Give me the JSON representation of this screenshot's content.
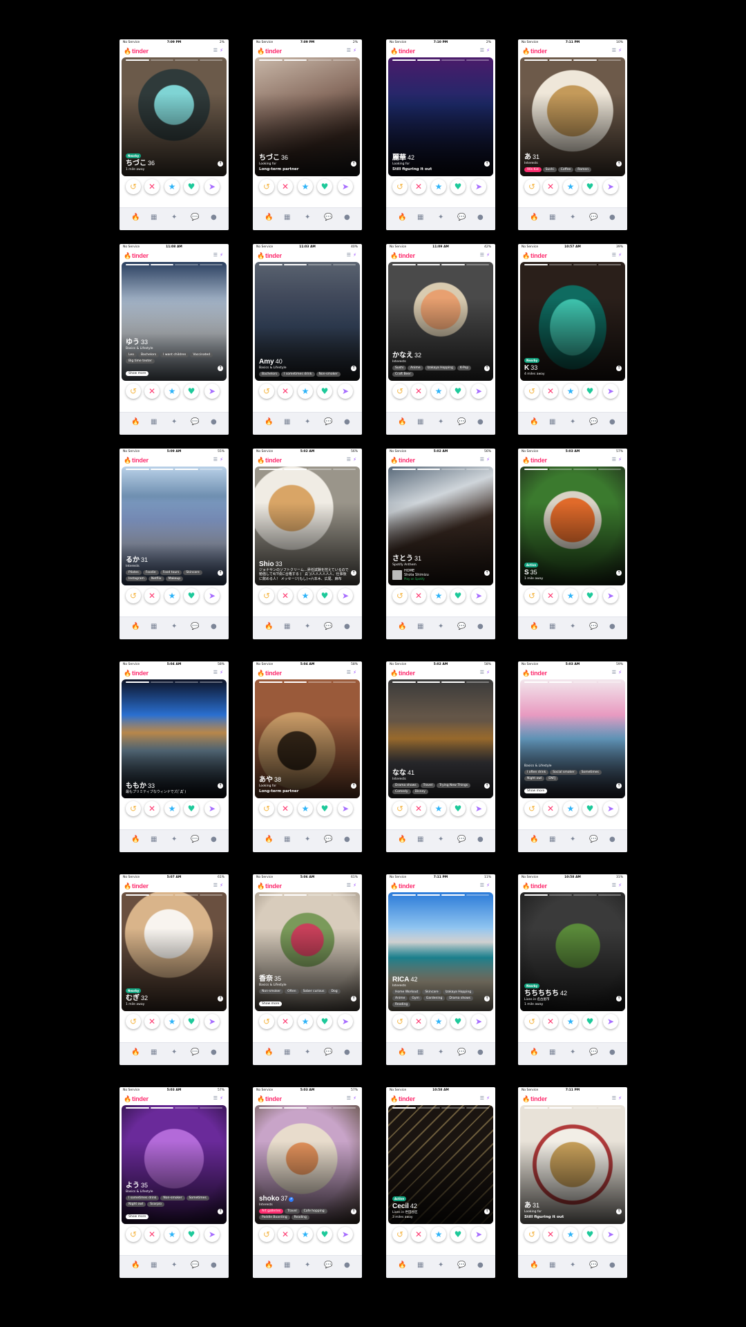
{
  "app": {
    "logo": "tinder",
    "carrier": "No Service"
  },
  "icons": {
    "flame": "flame-icon",
    "filter": "sliders-icon",
    "boost": "bolt-icon",
    "rewind": "rewind-icon",
    "nope": "x-icon",
    "super": "star-icon",
    "like": "heart-icon",
    "message": "send-icon",
    "up": "arrow-up-icon"
  },
  "colors": {
    "brand": "#fd2c6e",
    "nearby": "#11a37f",
    "like": "#1dc99a",
    "superlike": "#2db3f8"
  },
  "cards": [
    {
      "time": "7:09 PM",
      "battery": "2%",
      "bg": "radial-gradient(circle at 50% 40%,#7fd4d4 0 22%,#2f3a3a 23% 40%,#6b5a4a 41%)",
      "badge": "Nearby",
      "name": "ちづこ",
      "age": "36",
      "lines": [
        {
          "k": "sub",
          "v": "1 mile away"
        }
      ],
      "chips": [],
      "progress": 1
    },
    {
      "time": "7:09 PM",
      "battery": "2%",
      "bg": "linear-gradient(160deg,#c8b7a8,#8a6f62 40%,#3b2a22 70%,#222)",
      "name": "ちづこ",
      "age": "36",
      "lines": [
        {
          "k": "sub",
          "v": "Looking for"
        },
        {
          "k": "subval",
          "v": "Long-term partner"
        }
      ],
      "chips": [],
      "progress": 2
    },
    {
      "time": "7:10 PM",
      "battery": "2%",
      "bg": "linear-gradient(180deg,#4b1b6a,#1d2a6a 40%,#0c0c1c)",
      "name": "麗華",
      "age": "42",
      "lines": [
        {
          "k": "sub",
          "v": "Looking for"
        },
        {
          "k": "subval",
          "v": "Still figuring it out"
        }
      ],
      "chips": [],
      "progress": 2
    },
    {
      "time": "7:11 PM",
      "battery": "10%",
      "bg": "radial-gradient(circle at 50% 45%,#c49a5a 0 30%,#efe7d9 31% 48%,#6d5a4a 49%)",
      "name": "あ",
      "age": "31",
      "lines": [
        {
          "k": "sub",
          "v": "Interests"
        }
      ],
      "chips": [
        "90s Kid",
        "Sushi",
        "Coffee",
        "Ramen"
      ],
      "hotFirst": true,
      "progress": 3
    },
    {
      "time": "11:08 AM",
      "battery": "",
      "bg": "linear-gradient(180deg,#2a3f5f,#a9b9cc 35%,#e8eef4 60%,#9aa7b5)",
      "name": "ゆう",
      "age": "33",
      "lines": [
        {
          "k": "sub",
          "v": "Basics & Lifestyle"
        }
      ],
      "chips": [
        "Leo",
        "Bachelors",
        "I want children",
        "Vaccinated",
        "Big time texter"
      ],
      "more": "Show more",
      "progress": 2
    },
    {
      "time": "11:03 AM",
      "battery": "40%",
      "bg": "linear-gradient(180deg,#5a6370,#40485a 30%,#3d4f6b 55%,#2a2e33)",
      "name": "Amy",
      "age": "40",
      "lines": [
        {
          "k": "sub",
          "v": "Basics & Lifestyle"
        }
      ],
      "chips": [
        "Bachelors",
        "I sometimes drink",
        "Non-smoker"
      ],
      "progress": 2
    },
    {
      "time": "11:09 AM",
      "battery": "42%",
      "bg": "radial-gradient(circle at 50% 40%,#e8a070 0 22%,#d9cbb0 23% 30%,#4a4a4a 31%)",
      "name": "かなえ",
      "age": "32",
      "lines": [
        {
          "k": "sub",
          "v": "Interests"
        }
      ],
      "chips": [
        "Sushi",
        "Anime",
        "Izakaya Hopping",
        "K-Pop",
        "Craft Beer"
      ],
      "progress": 3
    },
    {
      "time": "10:57 AM",
      "battery": "39%",
      "bg": "radial-gradient(ellipse at 50% 55%,#3fc6b0 0 30%,#0f6b60 31% 45%,#2a1f1a 46%)",
      "badge": "Nearby",
      "name": "K",
      "age": "33",
      "lines": [
        {
          "k": "sub",
          "v": "4 miles away"
        }
      ],
      "chips": [],
      "progress": 1
    },
    {
      "time": "5:09 AM",
      "battery": "55%",
      "bg": "linear-gradient(180deg,#b9d1e8,#6f8fb0 25%,#8da6d9 45%,#c7d3f0 65%,#4f6a9a)",
      "name": "るか",
      "age": "31",
      "lines": [
        {
          "k": "sub",
          "v": "Interests"
        }
      ],
      "chips": [
        "Pilates",
        "Foodie",
        "Food tours",
        "Skincare",
        "Instagram",
        "Netflix",
        "Makeup"
      ],
      "progress": 3
    },
    {
      "time": "5:02 AM",
      "battery": "56%",
      "bg": "radial-gradient(circle at 35% 35%,#d9a566 0 22%,#f0ece4 23% 40%,#9a958a 41%)",
      "name": "Shio",
      "age": "33",
      "lines": [
        {
          "k": "quote",
          "v": "ジョナサンのソフトクリーム…昇任試験を控えているので勉強して4/7頃に合格する (｀Д´)/人人人人人人、仕事後に飲める人！ メッセージ(もし)→六本木、広尾、麻布"
        }
      ],
      "chips": [],
      "progress": 2
    },
    {
      "time": "5:02 AM",
      "battery": "56%",
      "bg": "linear-gradient(160deg,#5a6a7a,#cfd5da 30%,#3a2a22 55%,#2a1e18)",
      "name": "さとう",
      "age": "31",
      "lines": [
        {
          "k": "sub",
          "v": "Spotify Anthem"
        }
      ],
      "spotify": {
        "song": "HOME",
        "artist": "Shota Shimizu",
        "play": "Play on Spotify"
      },
      "chips": [],
      "progress": 2
    },
    {
      "time": "5:03 AM",
      "battery": "57%",
      "bg": "radial-gradient(circle at 50% 45%,#e06a2a 0 26%,#d9d2c5 27% 34%,#3b7a2e 35% 55%,#1f2a1a)",
      "badge": "Active",
      "name": "S",
      "age": "35",
      "lines": [
        {
          "k": "sub",
          "v": "1 mile away"
        }
      ],
      "chips": [],
      "progress": 1
    },
    {
      "time": "5:04 AM",
      "battery": "58%",
      "bg": "linear-gradient(180deg,#0c1226,#2a6fd0 30%,#e0a45a 45%,#7a9ab0 60%,#0b0f1a)",
      "name": "ももか",
      "age": "33",
      "lines": [
        {
          "k": "quote",
          "v": "最もプリミティブなウィンナでズ(ﾟДﾟ)"
        }
      ],
      "chips": [],
      "progress": 1
    },
    {
      "time": "5:04 AM",
      "battery": "58%",
      "bg": "radial-gradient(circle at 40% 60%,#3a2a1a 0 20%,#c89a66 21% 40%,#9a5a3a 41%)",
      "name": "あや",
      "age": "38",
      "lines": [
        {
          "k": "sub",
          "v": "Looking for"
        },
        {
          "k": "subval",
          "v": "Long-term partner"
        }
      ],
      "chips": [],
      "progress": 2
    },
    {
      "time": "5:02 AM",
      "battery": "58%",
      "bg": "linear-gradient(180deg,#3a3a3a,#6a5a4a 35%,#c78a3a 50%,#4a4a50 70%)",
      "name": "なな",
      "age": "41",
      "lines": [
        {
          "k": "sub",
          "v": "Interests"
        }
      ],
      "chips": [
        "Drama shows",
        "Travel",
        "Trying New Things",
        "Comedy",
        "Disney"
      ],
      "progress": 3
    },
    {
      "time": "5:03 AM",
      "battery": "59%",
      "bg": "linear-gradient(180deg,#f2e6ec,#e89ac0 30%,#7cc0ee 50%,#3a3a4a)",
      "name": "",
      "age": "",
      "lines": [
        {
          "k": "sub",
          "v": "Basics & Lifestyle"
        }
      ],
      "chips": [
        "I often drink",
        "Social smoker",
        "Sometimes",
        "Night owl",
        "ENFJ"
      ],
      "more": "Show more",
      "progress": 2
    },
    {
      "time": "5:07 AM",
      "battery": "61%",
      "bg": "radial-gradient(circle at 45% 35%,#f8f4ef 0 25%,#d9b48a 26% 45%,#6a5040 46%)",
      "badge": "Nearby",
      "name": "むぎ",
      "age": "32",
      "lines": [
        {
          "k": "sub",
          "v": "1 mile away"
        }
      ],
      "chips": [],
      "progress": 1
    },
    {
      "time": "5:06 AM",
      "battery": "61%",
      "bg": "radial-gradient(circle at 50% 40%,#c8405a 0 18%,#7a9a5a 19% 30%,#d8ccbc 31% 60%,#8a7e70)",
      "name": "香奈",
      "age": "35",
      "lines": [
        {
          "k": "sub",
          "v": "Basics & Lifestyle"
        }
      ],
      "chips": [
        "Non-smoker",
        "Often",
        "Sober curious",
        "Dog"
      ],
      "more": "Show more",
      "progress": 2
    },
    {
      "time": "7:11 PM",
      "battery": "11%",
      "bg": "linear-gradient(180deg,#2a7ad8,#8fc4f0 30%,#f2f2f2 42%,#27b6c9 55%,#e8dcc0 75%)",
      "name": "RICA",
      "age": "42",
      "lines": [
        {
          "k": "sub",
          "v": "Interests"
        }
      ],
      "chips": [
        "Home Workout",
        "Skincare",
        "Izakaya Hopping",
        "Anime",
        "Gym",
        "Gardening",
        "Drama shows",
        "Reading"
      ],
      "progress": 3
    },
    {
      "time": "10:58 AM",
      "battery": "31%",
      "bg": "radial-gradient(circle at 55% 45%,#5a8a3a 0 25%,#3a3a3a 26% 55%,#1a1a1a)",
      "badge": "Nearby",
      "name": "ちちちちち",
      "age": "42",
      "lines": [
        {
          "k": "sub",
          "v": "Lives in 名古屋市"
        },
        {
          "k": "sub",
          "v": "1 mile away"
        }
      ],
      "chips": [],
      "progress": 1
    },
    {
      "time": "5:03 AM",
      "battery": "57%",
      "bg": "radial-gradient(circle at 50% 45%,#b36ad9 0 35%,#6a2a9a 36% 60%,#2a1040)",
      "name": "よう",
      "age": "35",
      "lines": [
        {
          "k": "sub",
          "v": "Basics & Lifestyle"
        }
      ],
      "chips": [
        "I sometimes drink",
        "Non-smoker",
        "Sometimes",
        "Night owl",
        "Scorpio"
      ],
      "more": "Show more",
      "progress": 2
    },
    {
      "time": "5:03 AM",
      "battery": "57%",
      "bg": "radial-gradient(circle at 45% 45%,#e0905a 0 18%,#e8dccc 19% 40%,#c8a4c8 41% 55%,#5a4a3a)",
      "name": "shoko",
      "age": "37",
      "verified": "✓",
      "lines": [
        {
          "k": "sub",
          "v": "Interests"
        }
      ],
      "chips": [
        "Art galleries",
        "Travel",
        "Cafe hopping",
        "Paddle Boarding",
        "Reading"
      ],
      "hotFirst": true,
      "progress": 2
    },
    {
      "time": "10:58 AM",
      "battery": "",
      "bg": "repeating-linear-gradient(135deg,#1a1410 0 6px,#6a5a3a 6px 8px,#1a1410 8px 14px)",
      "badge": "Active",
      "name": "Cecil",
      "age": "42",
      "lines": [
        {
          "k": "sub",
          "v": "Lives in 世田谷区"
        },
        {
          "k": "sub",
          "v": "3 miles away"
        }
      ],
      "chips": [],
      "progress": 1
    },
    {
      "time": "7:11 PM",
      "battery": "",
      "bg": "radial-gradient(circle at 50% 50%,#c8a05a 0 28%,#f2eee6 29% 45%,#b03a3a 46% 50%,#e8e2d8 51%)",
      "name": "あ",
      "age": "31",
      "lines": [
        {
          "k": "sub",
          "v": "Looking for"
        },
        {
          "k": "subval",
          "v": "Still figuring it out"
        }
      ],
      "chips": [],
      "progress": 2
    }
  ]
}
